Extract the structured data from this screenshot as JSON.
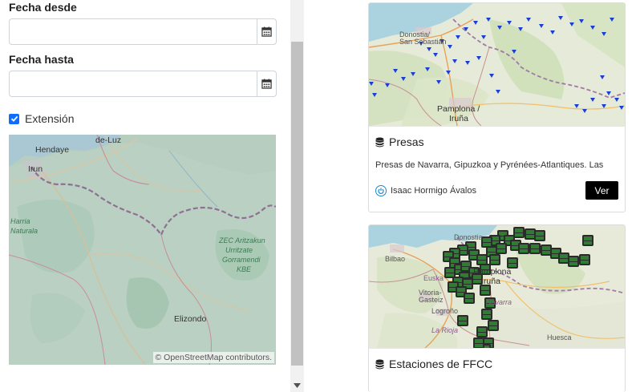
{
  "filters": {
    "fecha_desde_label": "Fecha desde",
    "fecha_desde_value": "",
    "fecha_hasta_label": "Fecha hasta",
    "fecha_hasta_value": "",
    "extension_label": "Extensión",
    "extension_checked": true
  },
  "mini_map": {
    "labels": {
      "hendaye": "Hendaye",
      "irun": "Irun",
      "luz": "de-Luz",
      "harria": "Harria",
      "natural": "Naturala",
      "zec": "ZEC Aritzakun",
      "urritzate": "Urritzate",
      "gorramendi": "Gorramendi",
      "kbe": "KBE",
      "elizondo": "Elizondo"
    },
    "attribution": "© OpenStreetMap contributors."
  },
  "cards": [
    {
      "title": "Presas",
      "description": "Presas de Navarra, Gipuzkoa y Pyrénées-Atlantiques. Las",
      "author": "Isaac Hormigo Ávalos",
      "button": "Ver",
      "map_labels": {
        "donostia": "Donostia/",
        "san_sebastian": "San Sebastián",
        "pamplona": "Pamplona /",
        "iruna": "Iruña"
      }
    },
    {
      "title": "Estaciones de FFCC",
      "map_labels": {
        "donostia": "Donostia",
        "bilbao": "Bilbao",
        "pamplona": "Pamplona",
        "iruna": "Iruña",
        "euska": "Euska",
        "vitoria": "Vitoria-",
        "gasteiz": "Gasteiz",
        "logrono": "Logroño",
        "la_rioja": "La Rioja",
        "navarra": "Navarra",
        "huesca": "Huesca"
      }
    }
  ],
  "colors": {
    "checkbox": "#0d6efd",
    "button_bg": "#000000",
    "author_icon": "#1e88c7",
    "marker_presas": "#1a3fd6",
    "marker_ffcc": "#2e7d32"
  }
}
